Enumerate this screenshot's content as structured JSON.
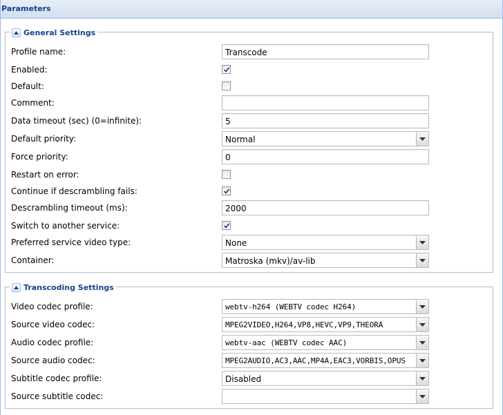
{
  "panel": {
    "title": "Parameters"
  },
  "general": {
    "legend": "General Settings",
    "fields": {
      "profile_name": {
        "label": "Profile name:",
        "value": "Transcode"
      },
      "enabled": {
        "label": "Enabled:",
        "checked": true
      },
      "default": {
        "label": "Default:",
        "checked": false
      },
      "comment": {
        "label": "Comment:",
        "value": ""
      },
      "data_timeout": {
        "label": "Data timeout (sec) (0=infinite):",
        "value": "5"
      },
      "default_priority": {
        "label": "Default priority:",
        "value": "Normal"
      },
      "force_priority": {
        "label": "Force priority:",
        "value": "0"
      },
      "restart_on_error": {
        "label": "Restart on error:",
        "checked": false
      },
      "continue_descrambling": {
        "label": "Continue if descrambling fails:",
        "checked": true
      },
      "descrambling_timeout": {
        "label": "Descrambling timeout (ms):",
        "value": "2000"
      },
      "switch_service": {
        "label": "Switch to another service:",
        "checked": true
      },
      "preferred_video_type": {
        "label": "Preferred service video type:",
        "value": "None"
      },
      "container": {
        "label": "Container:",
        "value": "Matroska (mkv)/av-lib"
      }
    }
  },
  "transcoding": {
    "legend": "Transcoding Settings",
    "fields": {
      "video_codec_profile": {
        "label": "Video codec profile:",
        "value": "webtv-h264 (WEBTV codec H264)"
      },
      "source_video_codec": {
        "label": "Source video codec:",
        "value": "MPEG2VIDEO,H264,VP8,HEVC,VP9,THEORA"
      },
      "audio_codec_profile": {
        "label": "Audio codec profile:",
        "value": "webtv-aac (WEBTV codec AAC)"
      },
      "source_audio_codec": {
        "label": "Source audio codec:",
        "value": "MPEG2AUDIO,AC3,AAC,MP4A,EAC3,VORBIS,OPUS"
      },
      "subtitle_codec_profile": {
        "label": "Subtitle codec profile:",
        "value": "Disabled"
      },
      "source_subtitle_codec": {
        "label": "Source subtitle codec:",
        "value": ""
      }
    }
  }
}
